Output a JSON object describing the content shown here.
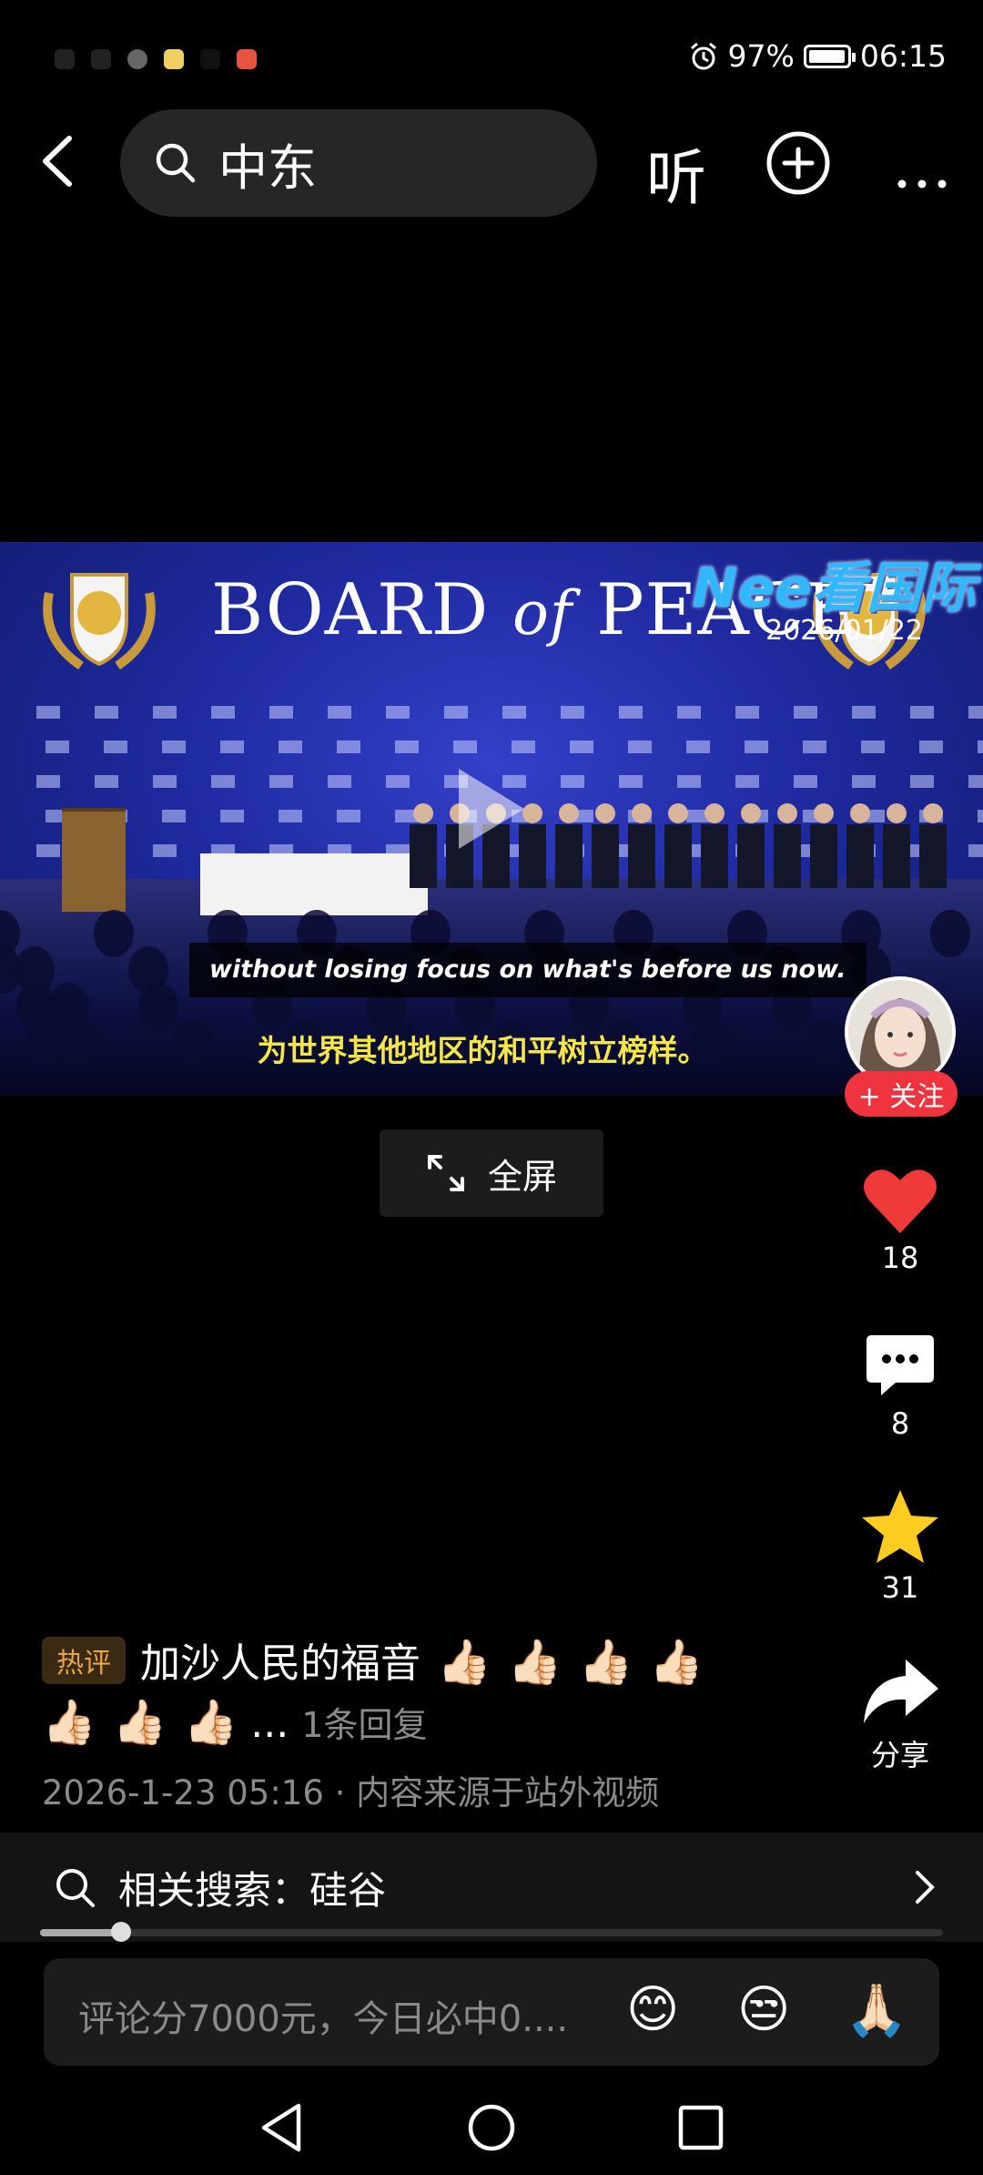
{
  "status": {
    "battery": "97%",
    "battery_level": 0.97,
    "time": "06:15",
    "notif_colors": [
      "#555555",
      "#666666",
      "#f1cf63",
      "#e5543f"
    ]
  },
  "topbar": {
    "search_query": "中东",
    "listen_label": "听",
    "icons": [
      "back-arrow-icon",
      "search-icon",
      "plus-circle-icon",
      "more-icon"
    ]
  },
  "video": {
    "banner_title_1": "BOARD",
    "banner_title_2": "of",
    "banner_title_3": "PEACE",
    "channel_watermark": "Nee看国际",
    "date": "2026/01/22",
    "subtitle_en": "without losing focus on what's before us now.",
    "subtitle_cn": "为世界其他地区的和平树立榜样。"
  },
  "author": {
    "follow_label": "+ 关注"
  },
  "fullscreen_label": "全屏",
  "actions": {
    "likes": "18",
    "comments": "8",
    "favorites": "31",
    "share_label": "分享",
    "like_color": "#f03a3a",
    "favorite_color": "#ffcc22"
  },
  "hot_comment": {
    "badge": "热评",
    "text": "加沙人民的福音",
    "emoji": "👍🏻",
    "ellipsis": "...",
    "reply_count": "1条回复"
  },
  "post_meta": "2026-1-23 05:16 · 内容来源于站外视频",
  "related_search": {
    "label": "相关搜索：硅谷"
  },
  "playback_progress": 0.09,
  "comment_input": {
    "placeholder": "评论分7000元，今日必中0....",
    "emojis": [
      "😊",
      "😒",
      "🙏🏻"
    ]
  },
  "nav_icons": [
    "nav-back-icon",
    "nav-home-icon",
    "nav-recents-icon"
  ]
}
